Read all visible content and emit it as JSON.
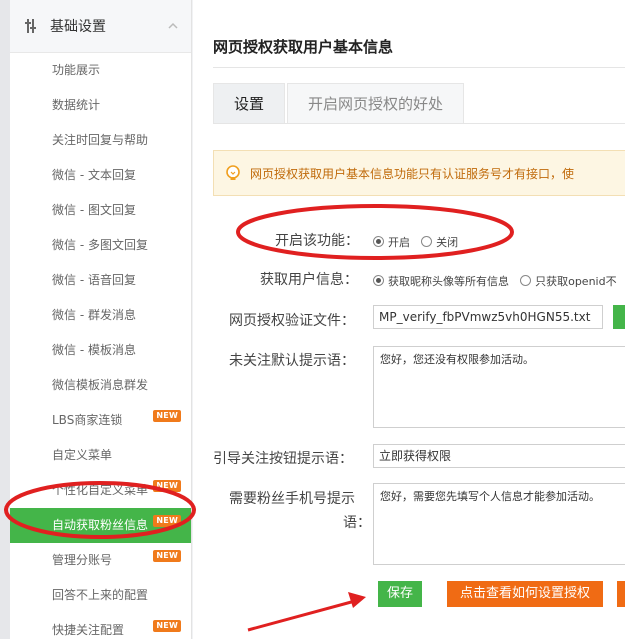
{
  "sidebar": {
    "header": "基础设置",
    "items": [
      {
        "label": "功能展示",
        "new": ""
      },
      {
        "label": "数据统计",
        "new": ""
      },
      {
        "label": "关注时回复与帮助",
        "new": ""
      },
      {
        "label": "微信 - 文本回复",
        "new": ""
      },
      {
        "label": "微信 - 图文回复",
        "new": ""
      },
      {
        "label": "微信 - 多图文回复",
        "new": ""
      },
      {
        "label": "微信 - 语音回复",
        "new": ""
      },
      {
        "label": "微信 - 群发消息",
        "new": ""
      },
      {
        "label": "微信 - 模板消息",
        "new": ""
      },
      {
        "label": "微信模板消息群发",
        "new": ""
      },
      {
        "label": "LBS商家连锁",
        "new": "NEW"
      },
      {
        "label": "自定义菜单",
        "new": ""
      },
      {
        "label": "个性化自定义菜单",
        "new": "NEW"
      },
      {
        "label": "自动获取粉丝信息",
        "new": "NEW"
      },
      {
        "label": "管理分账号",
        "new": "NEW"
      },
      {
        "label": "回答不上来的配置",
        "new": ""
      },
      {
        "label": "快捷关注配置",
        "new": "NEW"
      }
    ],
    "active_index": 13
  },
  "main": {
    "title": "网页授权获取用户基本信息",
    "tabs": [
      "设置",
      "开启网页授权的好处"
    ],
    "notice": "网页授权获取用户基本信息功能只有认证服务号才有接口，使",
    "enable": {
      "label": "开启该功能：",
      "options": [
        "开启",
        "关闭"
      ],
      "selected": 0
    },
    "userinfo": {
      "label": "获取用户信息：",
      "options": [
        "获取昵称头像等所有信息",
        "只获取openid不"
      ],
      "selected": 0
    },
    "verify_file": {
      "label": "网页授权验证文件：",
      "value": "MP_verify_fbPVmwz5vh0HGN55.txt"
    },
    "unfollow_tip": {
      "label": "未关注默认提示语：",
      "value": "您好，您还没有权限参加活动。"
    },
    "guide_btn": {
      "label": "引导关注按钮提示语：",
      "value": "立即获得权限"
    },
    "phone_tip": {
      "label_line1": "需要粉丝手机号提示",
      "label_line2": "语：",
      "value": "您好，需要您先填写个人信息才能参加活动。"
    },
    "buttons": {
      "save": "保存",
      "howto": "点击查看如何设置授权"
    }
  },
  "colors": {
    "accent_green": "#44b549",
    "button_orange": "#f06b14",
    "annotation_red": "#e02020",
    "notice_bg": "#fdf6e3"
  }
}
